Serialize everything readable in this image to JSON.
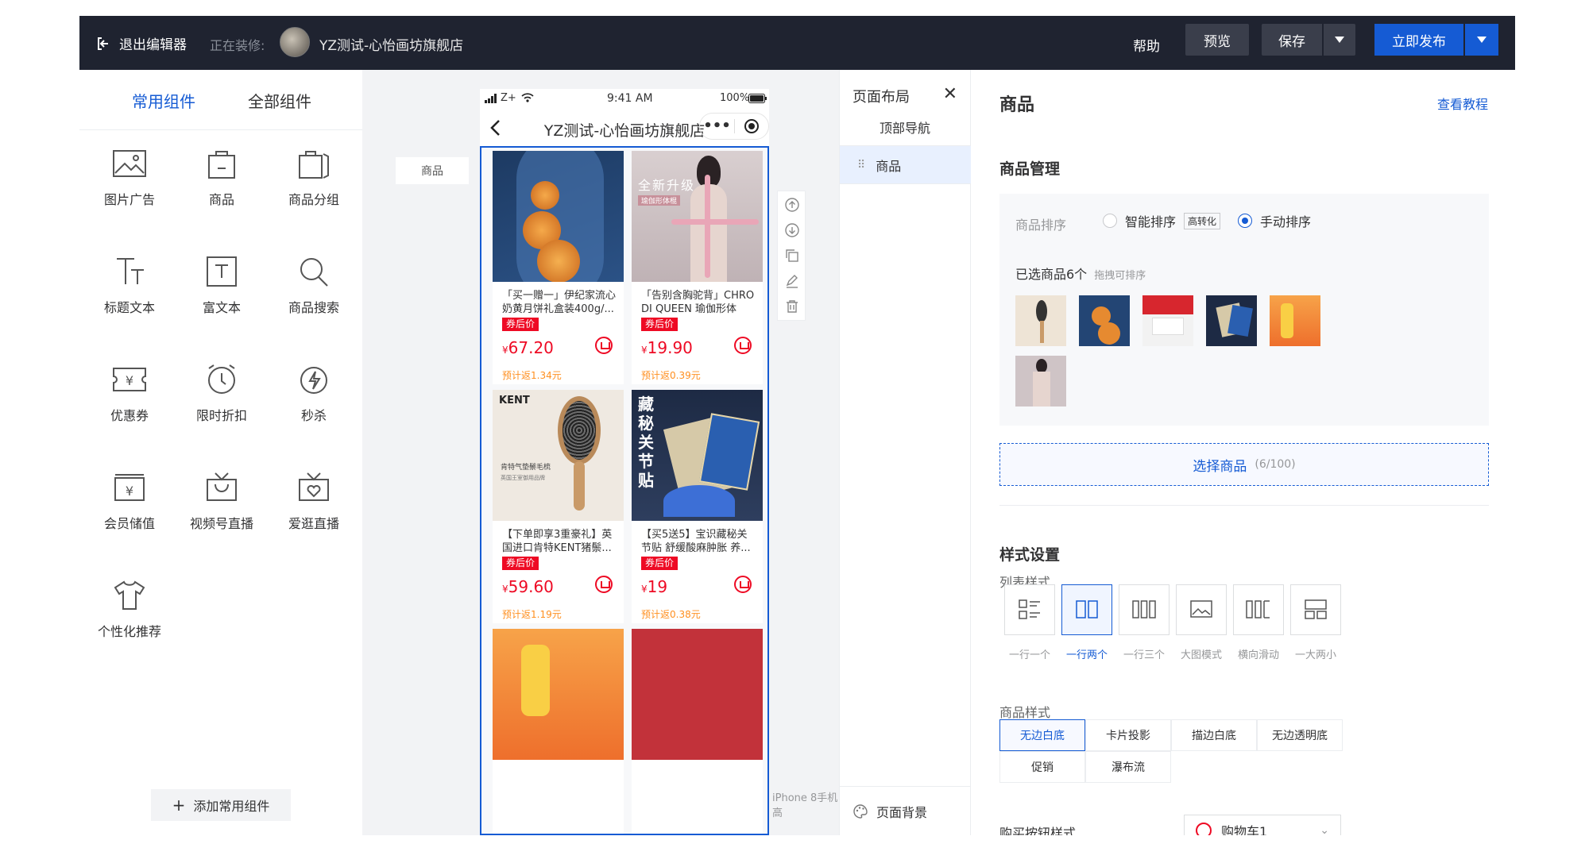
{
  "topbar": {
    "exit_label": "退出编辑器",
    "editing_label": "正在装修:",
    "shop_name": "YZ测试-心怡画坊旗舰店",
    "help_label": "帮助",
    "preview_label": "预览",
    "save_label": "保存",
    "publish_label": "立即发布"
  },
  "left_panel": {
    "tabs": [
      "常用组件",
      "全部组件"
    ],
    "components": [
      "图片广告",
      "商品",
      "商品分组",
      "标题文本",
      "富文本",
      "商品搜索",
      "优惠券",
      "限时折扣",
      "秒杀",
      "会员储值",
      "视频号直播",
      "爱逛直播",
      "个性化推荐"
    ],
    "add_label": "添加常用组件"
  },
  "canvas": {
    "side_label": "商品",
    "status_carrier": "Z+",
    "status_time": "9:41 AM",
    "status_battery": "100%",
    "phone_title": "YZ测试-心怡画坊旗舰店",
    "iphone_label": "iPhone 8手机高",
    "goods": [
      {
        "title": "「买一赠一」伊纪家流心奶黄月饼礼盒装400g/...",
        "tag": "券后价",
        "currency": "¥",
        "price": "67.20",
        "rebate": "预计返1.34元"
      },
      {
        "title": "「告别含胸驼背」CHRO DI QUEEN 瑜伽形体棍...",
        "tag": "券后价",
        "currency": "¥",
        "price": "19.90",
        "rebate": "预计返0.39元"
      },
      {
        "title": "【下单即享3重豪礼】英国进口肯特KENT猪鬃...",
        "tag": "券后价",
        "currency": "¥",
        "price": "59.60",
        "rebate": "预计返1.19元"
      },
      {
        "title": "【买5送5】宝识藏秘关节贴 舒缓酸麻肿胀 养...",
        "tag": "券后价",
        "currency": "¥",
        "price": "19",
        "rebate": "预计返0.38元"
      }
    ],
    "img_text": {
      "yoga_big": "全新升级",
      "yoga_small": "瑜伽形体棍",
      "kent": "KENT",
      "kent_sub": "肯特气垫鬃毛梳",
      "kent_sub2": "英国王室御用品牌",
      "patch": "藏秘关节贴"
    }
  },
  "layout_panel": {
    "title": "页面布局",
    "items": [
      "顶部导航",
      "商品"
    ],
    "bg_label": "页面背景"
  },
  "props": {
    "title": "商品",
    "tutorial": "查看教程",
    "manage_title": "商品管理",
    "sort_label": "商品排序",
    "sort_smart": "智能排序",
    "sort_smart_badge": "高转化",
    "sort_manual": "手动排序",
    "selected_label": "已选商品6个",
    "drag_hint": "拖拽可排序",
    "select_btn": "选择商品",
    "select_count": "(6/100)",
    "style_title": "样式设置",
    "list_style_label": "列表样式",
    "list_styles": [
      "一行一个",
      "一行两个",
      "一行三个",
      "大图模式",
      "横向滑动",
      "一大两小"
    ],
    "goods_style_label": "商品样式",
    "goods_styles": [
      "无边白底",
      "卡片投影",
      "描边白底",
      "无边透明底",
      "促销",
      "瀑布流"
    ],
    "buy_btn_label": "购买按钮样式",
    "buy_btn_value": "购物车1"
  },
  "colors": {
    "accent": "#155bd4",
    "price": "#ee0a24",
    "rebate": "#ff8f1f",
    "topbar": "#1f2330"
  }
}
